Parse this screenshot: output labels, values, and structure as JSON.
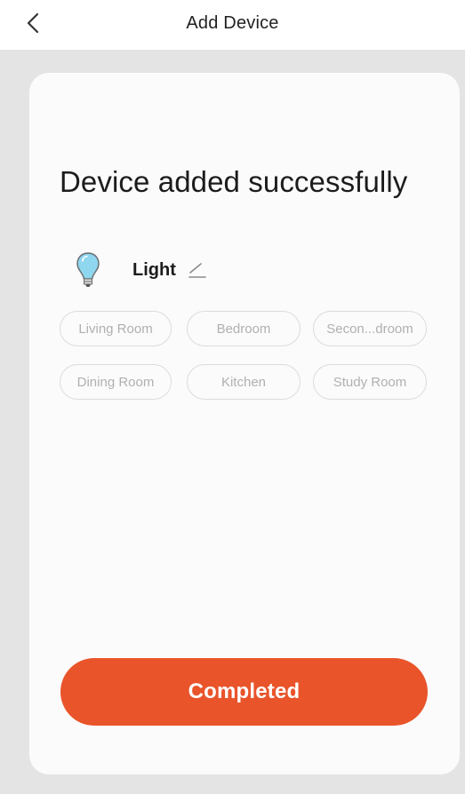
{
  "header": {
    "title": "Add Device",
    "back_icon": "chevron-left-icon"
  },
  "main": {
    "success_title": "Device added successfully",
    "device": {
      "icon": "light-bulb-icon",
      "name": "Light",
      "edit_icon": "pencil-icon"
    },
    "rooms": [
      "Living Room",
      "Bedroom",
      "Secon...droom",
      "Dining Room",
      "Kitchen",
      "Study Room"
    ],
    "complete_label": "Completed"
  },
  "colors": {
    "accent": "#e9542a",
    "page_background": "#e4e4e4",
    "card_background": "#fbfbfb",
    "chip_text": "#b0b0b0",
    "bulb": "#8fd6ef"
  }
}
